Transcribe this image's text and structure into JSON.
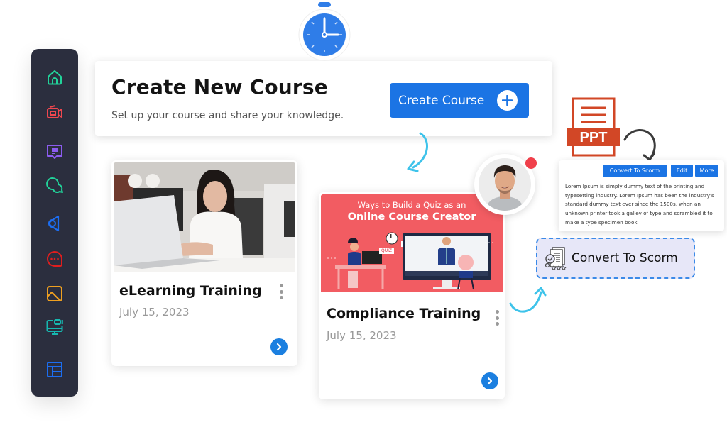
{
  "sidebar": {
    "items": [
      {
        "name": "home",
        "icon": "home-icon",
        "color": "#22d39a"
      },
      {
        "name": "video",
        "icon": "video-camera-icon",
        "color": "#f0474f"
      },
      {
        "name": "messages",
        "icon": "message-text-icon",
        "color": "#8c5cf0"
      },
      {
        "name": "chat",
        "icon": "chat-bubbles-icon",
        "color": "#22d39a"
      },
      {
        "name": "announcements",
        "icon": "megaphone-icon",
        "color": "#1c6df0"
      },
      {
        "name": "comments",
        "icon": "comment-dots-icon",
        "color": "#e01e1e"
      },
      {
        "name": "media",
        "icon": "image-icon",
        "color": "#f0a020"
      },
      {
        "name": "webinar",
        "icon": "monitor-camera-icon",
        "color": "#16b8b0"
      },
      {
        "name": "layout",
        "icon": "layout-panels-icon",
        "color": "#1c6df0"
      }
    ]
  },
  "header": {
    "title": "Create New Course",
    "subtitle": "Set up your course and share your knowledge.",
    "create_button_label": "Create Course"
  },
  "courses": [
    {
      "title": "eLearning Training",
      "date": "July 15, 2023",
      "thumbnail": "woman-laptop-photo"
    },
    {
      "title": "Compliance Training",
      "date": "July 15, 2023",
      "thumbnail": "quiz-banner",
      "banner_line1": "Ways to Build a Quiz as an",
      "banner_line2": "Online Course Creator",
      "banner_tag": "QUIZ"
    }
  ],
  "document": {
    "file_label": "PPT",
    "buttons": {
      "convert": "Convert To Scorm",
      "edit": "Edit",
      "more": "More"
    },
    "description": "Lorem Ipsum is simply dummy text of the printing and typesetting industry. Lorem Ipsum has been the industry's standard dummy text ever since the 1500s, when an unknown printer took a galley of type and scrambled it to make a type specimen book."
  },
  "scorm": {
    "label": "Convert To Scorm"
  },
  "colors": {
    "primary": "#1b74e4",
    "sidebar_bg": "#2b2e3e",
    "ppt_red": "#d24726",
    "notification": "#f0404b",
    "arrow_cyan": "#3ec3ea"
  }
}
